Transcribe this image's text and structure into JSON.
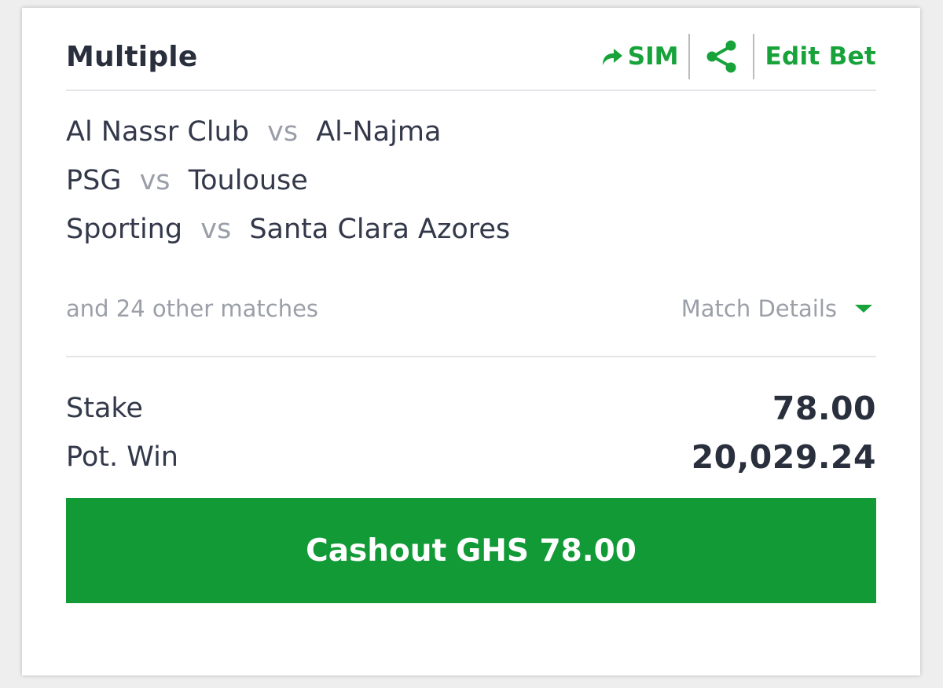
{
  "bet": {
    "title": "Multiple",
    "actions": {
      "sim_label": "SIM",
      "share_icon": "share-icon",
      "edit_label": "Edit Bet"
    },
    "matches": [
      {
        "home": "Al Nassr Club",
        "vs": "vs",
        "away": "Al-Najma"
      },
      {
        "home": "PSG",
        "vs": "vs",
        "away": "Toulouse"
      },
      {
        "home": "Sporting",
        "vs": "vs",
        "away": "Santa Clara Azores"
      }
    ],
    "more_matches": "and 24 other matches",
    "match_details_label": "Match Details",
    "stake_label": "Stake",
    "stake_value": "78.00",
    "potwin_label": "Pot. Win",
    "potwin_value": "20,029.24",
    "cashout": {
      "label": "Cashout",
      "amount": "GHS 78.00"
    }
  },
  "colors": {
    "accent_green": "#17a33a",
    "cashout_bg": "#129a37",
    "text_dark": "#2a2f3d",
    "text_muted": "#9b9fa8"
  }
}
